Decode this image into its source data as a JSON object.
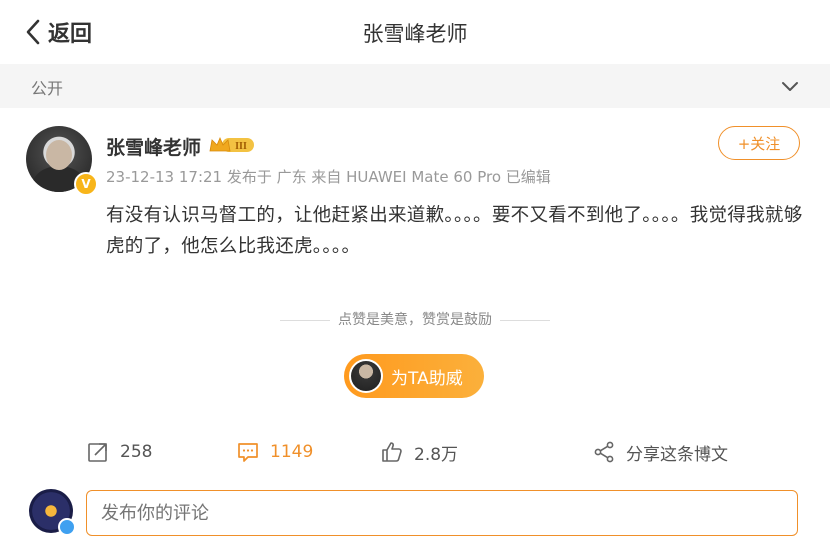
{
  "header": {
    "back_label": "返回",
    "title": "张雪峰老师"
  },
  "visibility": {
    "label": "公开"
  },
  "post": {
    "author": "张雪峰老师",
    "level_badge": "III",
    "verified_badge": "V",
    "follow_label": "+关注",
    "meta": "23-12-13 17:21 发布于 广东 来自 HUAWEI Mate 60 Pro 已编辑",
    "content": "有没有认识马督工的，让他赶紧出来道歉。。。。要不又看不到他了。。。。我觉得我就够虎的了，他怎么比我还虎。。。。"
  },
  "reward": {
    "text": "点赞是美意，赞赏是鼓励",
    "button_label": "为TA助威"
  },
  "actions": {
    "repost_count": "258",
    "comment_count": "1149",
    "like_count": "2.8万",
    "share_label": "分享这条博文"
  },
  "comment": {
    "placeholder": "发布你的评论"
  },
  "colors": {
    "accent": "#f0902a",
    "text": "#333333",
    "meta": "#999999"
  }
}
